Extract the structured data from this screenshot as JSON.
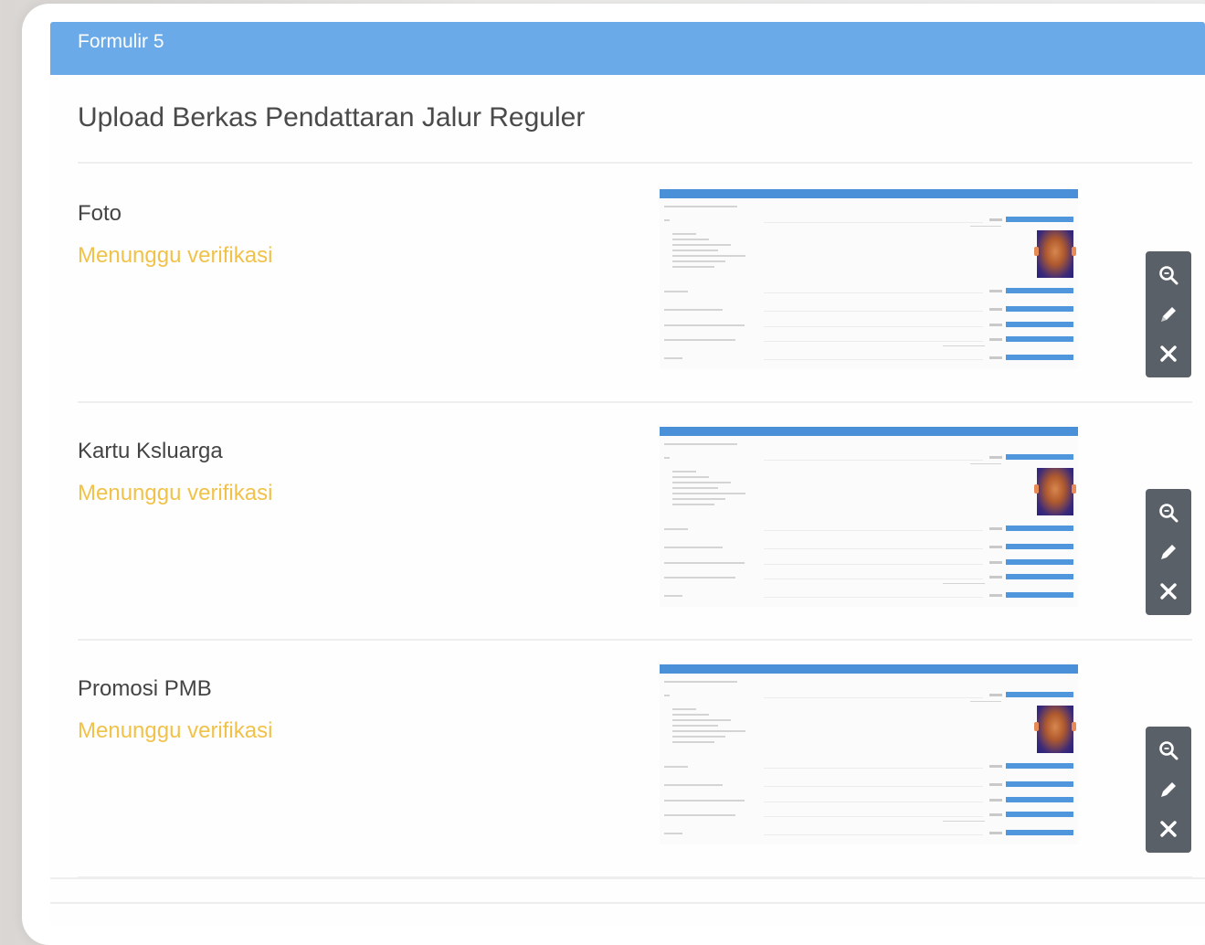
{
  "panel": {
    "header": "Formulir 5",
    "title": "Upload Berkas Pendattaran Jalur Reguler"
  },
  "documents": [
    {
      "label": "Foto",
      "status": "Menunggu verifikasi"
    },
    {
      "label": "Kartu Ksluarga",
      "status": "Menunggu verifikasi"
    },
    {
      "label": "Promosi PMB",
      "status": "Menunggu verifikasi"
    }
  ],
  "actions": {
    "view_icon": "search-icon",
    "edit_icon": "pencil-icon",
    "delete_icon": "close-icon"
  },
  "colors": {
    "header_bg": "#6aaae8",
    "status": "#f0c24a",
    "toolbar_bg": "#5a6067"
  }
}
